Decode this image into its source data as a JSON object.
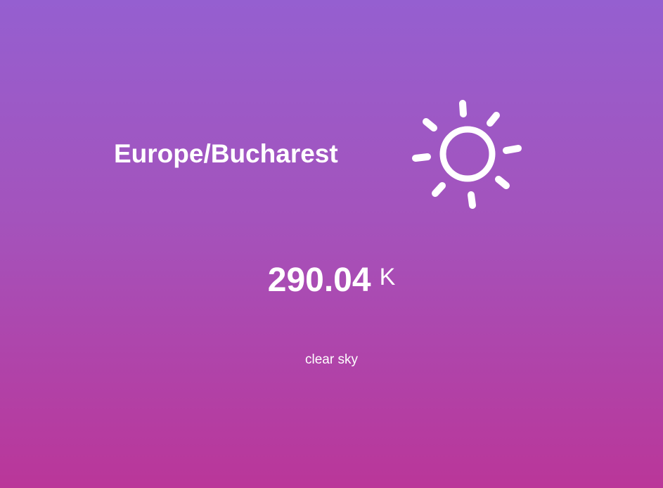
{
  "weather": {
    "location": "Europe/Bucharest",
    "icon": "sun-icon",
    "temperature": "290.04",
    "unit": "K",
    "description": "clear sky"
  },
  "colors": {
    "background_top": "#955fd0",
    "background_bottom": "#ba3699",
    "text": "#ffffff"
  }
}
